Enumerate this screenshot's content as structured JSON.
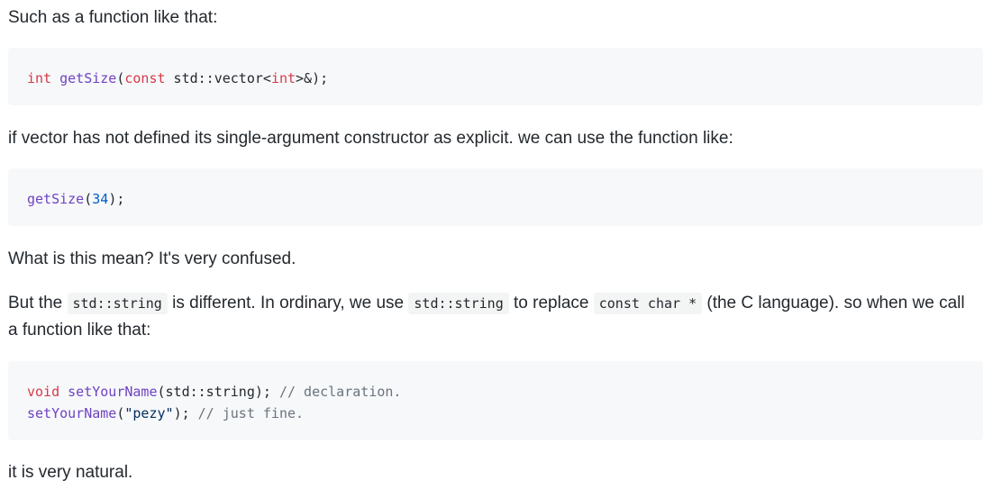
{
  "p1": "Such as a function like that:",
  "code1": {
    "kw_int": "int",
    "fn_getsize": "getSize",
    "paren_open": "(",
    "kw_const": "const",
    "type_part": " std::vector<",
    "kw_int2": "int",
    "rest": ">&);"
  },
  "p2": "if vector has not defined its single-argument constructor as explicit. we can use the function like:",
  "code2": {
    "fn_getsize": "getSize",
    "paren_open": "(",
    "num": "34",
    "rest": ");"
  },
  "p3": "What is this mean? It's very confused.",
  "p4": {
    "part1": "But the ",
    "code1": "std::string",
    "part2": " is different. In ordinary, we use ",
    "code2": "std::string",
    "part3": " to replace ",
    "code3": "const char *",
    "part4": " (the C language). so when we call a function like that:"
  },
  "code3": {
    "line1": {
      "kw_void": "void",
      "fn": "setYourName",
      "args": "(std::string); ",
      "comment": "// declaration."
    },
    "line2": {
      "fn": "setYourName",
      "paren_open": "(",
      "str": "\"pezy\"",
      "rest": "); ",
      "comment": "// just fine."
    }
  },
  "p5": "it is very natural."
}
